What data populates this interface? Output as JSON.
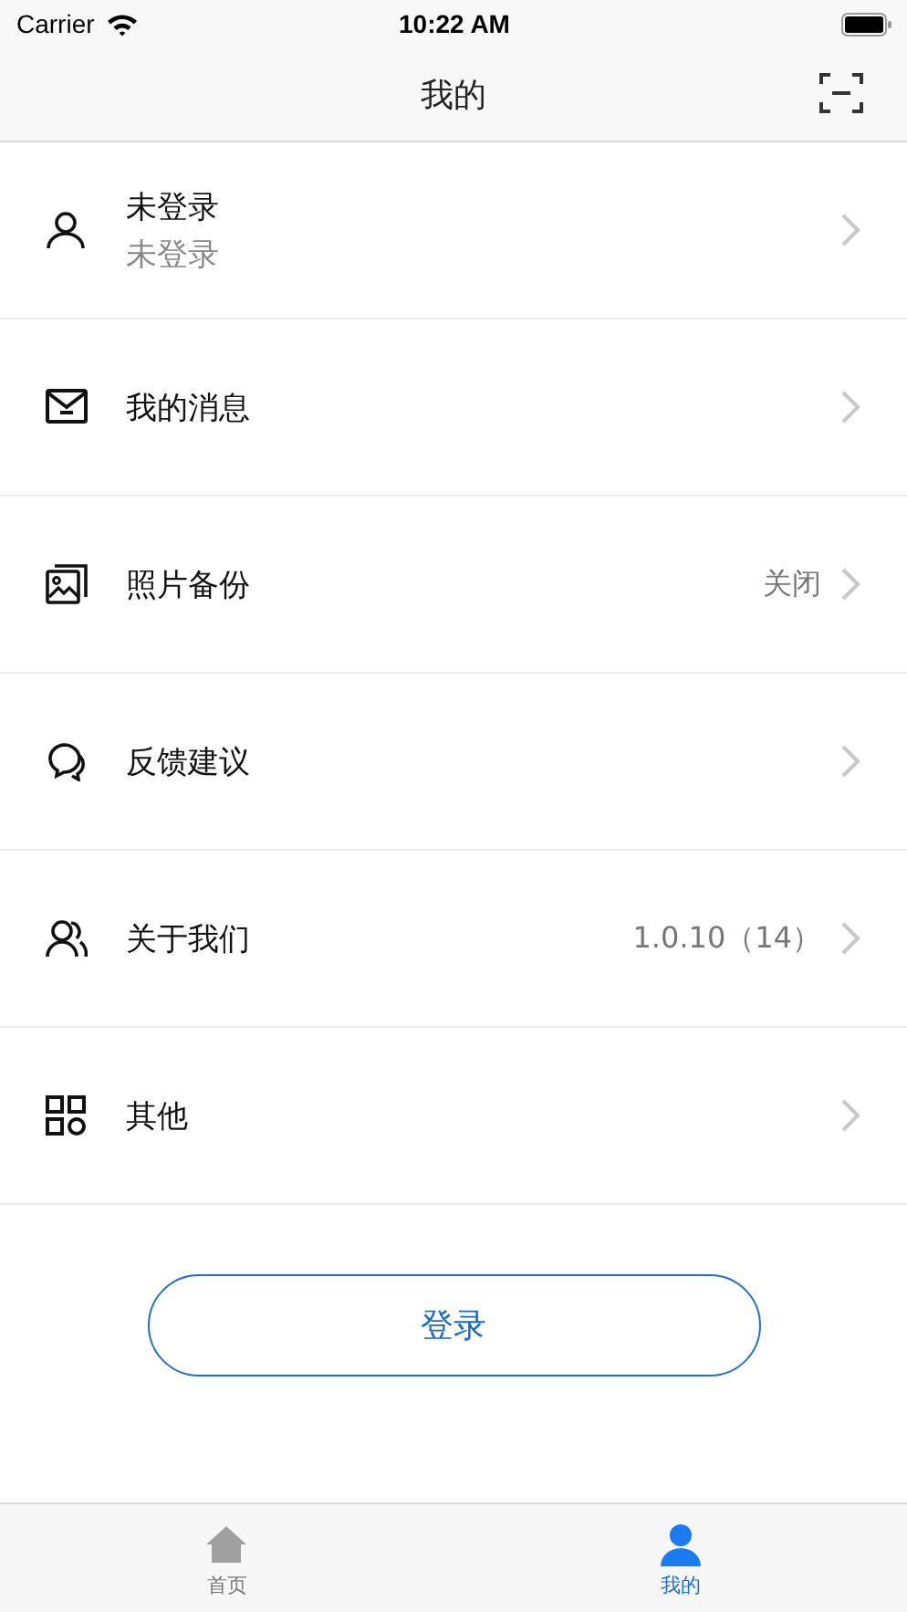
{
  "status_bar": {
    "carrier": "Carrier",
    "time": "10:22 AM"
  },
  "nav_bar": {
    "title": "我的"
  },
  "menu": [
    {
      "kind": "profile",
      "title": "未登录",
      "subtitle": "未登录"
    },
    {
      "kind": "item",
      "title": "我的消息"
    },
    {
      "kind": "item",
      "title": "照片备份",
      "value": "关闭"
    },
    {
      "kind": "item",
      "title": "反馈建议"
    },
    {
      "kind": "item",
      "title": "关于我们",
      "value": "1.0.10（14）"
    },
    {
      "kind": "item",
      "title": "其他"
    }
  ],
  "login_button": {
    "label": "登录"
  },
  "tab_bar": [
    {
      "label": "首页",
      "selected": false
    },
    {
      "label": "我的",
      "selected": true
    }
  ]
}
